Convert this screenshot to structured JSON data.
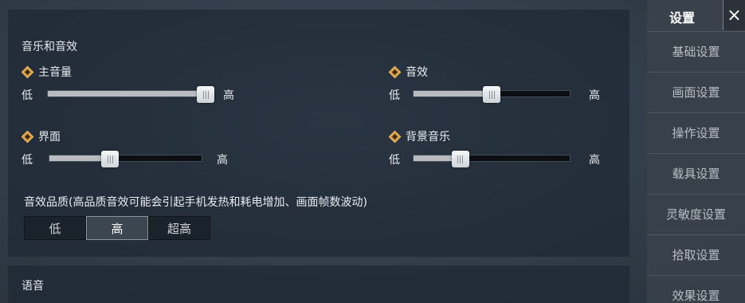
{
  "audio_section": {
    "title": "音乐和音效",
    "sliders": [
      {
        "label": "主音量",
        "min_label": "低",
        "max_label": "高",
        "value": 1.0
      },
      {
        "label": "音效",
        "min_label": "低",
        "max_label": "高",
        "value": 0.5
      },
      {
        "label": "界面",
        "min_label": "低",
        "max_label": "高",
        "value": 0.4
      },
      {
        "label": "背景音乐",
        "min_label": "低",
        "max_label": "高",
        "value": 0.3
      }
    ],
    "quality_label": "音效品质(高品质音效可能会引起手机发热和耗电增加、画面帧数波动)",
    "quality_options": [
      "低",
      "高",
      "超高"
    ],
    "quality_selected": "高"
  },
  "voice_section": {
    "title": "语音"
  },
  "sidebar": {
    "title": "设置",
    "close_icon": "×",
    "items": [
      "基础设置",
      "画面设置",
      "操作设置",
      "载具设置",
      "灵敏度设置",
      "拾取设置",
      "效果设置"
    ]
  },
  "colors": {
    "accent": "#d79a3c",
    "slider_fill": "#b8bcc0",
    "track": "#0b0f14"
  }
}
